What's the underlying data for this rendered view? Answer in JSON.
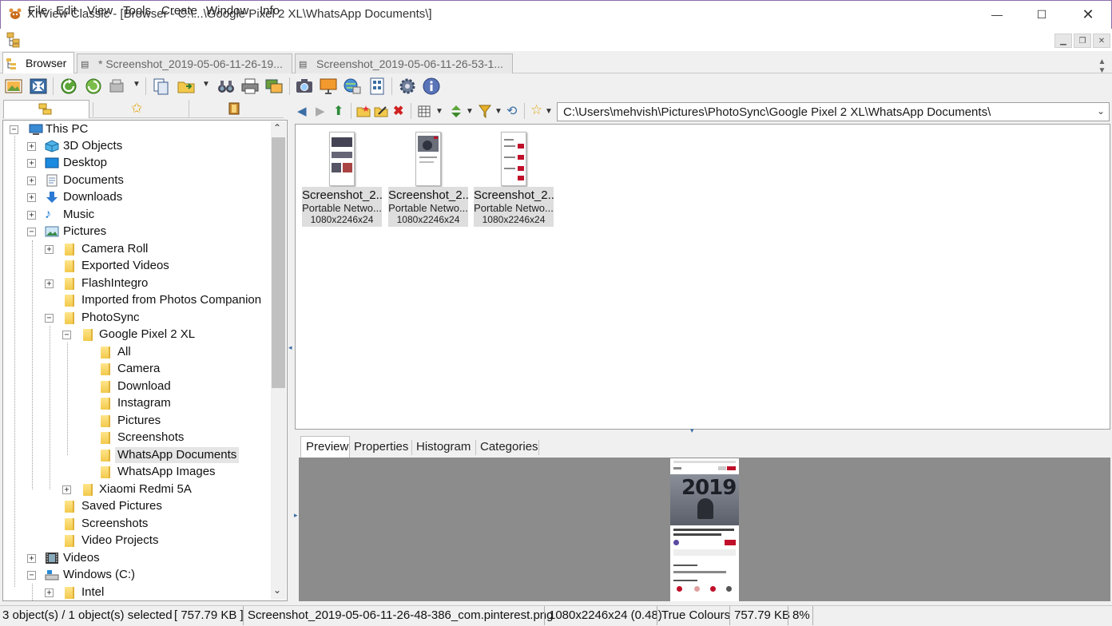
{
  "window": {
    "title": "XnView Classic - [Browser - C:\\...\\Google Pixel 2 XL\\WhatsApp Documents\\]",
    "minimize": "—",
    "maximize": "☐",
    "close": "✕"
  },
  "menu": [
    "File",
    "Edit",
    "View",
    "Tools",
    "Create",
    "Window",
    "Info"
  ],
  "mdi": {
    "minimize": "▁",
    "restore": "❐",
    "close": "✕"
  },
  "tabs": [
    {
      "label": "Browser"
    },
    {
      "label": "* Screenshot_2019-05-06-11-26-19..."
    },
    {
      "label": "Screenshot_2019-05-06-11-26-53-1..."
    }
  ],
  "path": {
    "value": "C:\\Users\\mehvish\\Pictures\\PhotoSync\\Google Pixel 2 XL\\WhatsApp Documents\\"
  },
  "tree": [
    {
      "label": "This PC",
      "icon": "computer-icon"
    },
    {
      "label": "3D Objects",
      "icon": "cube-icon"
    },
    {
      "label": "Desktop",
      "icon": "desktop-icon"
    },
    {
      "label": "Documents",
      "icon": "document-icon"
    },
    {
      "label": "Downloads",
      "icon": "download-arrow-icon"
    },
    {
      "label": "Music",
      "icon": "music-note-icon"
    },
    {
      "label": "Pictures",
      "icon": "pictures-icon"
    },
    {
      "label": "Camera Roll",
      "icon": "folder-icon"
    },
    {
      "label": "Exported Videos",
      "icon": "folder-icon"
    },
    {
      "label": "FlashIntegro",
      "icon": "folder-icon"
    },
    {
      "label": "Imported from Photos Companion",
      "icon": "folder-icon"
    },
    {
      "label": "PhotoSync",
      "icon": "folder-icon"
    },
    {
      "label": "Google Pixel 2 XL",
      "icon": "folder-icon"
    },
    {
      "label": "All",
      "icon": "folder-icon"
    },
    {
      "label": "Camera",
      "icon": "folder-icon"
    },
    {
      "label": "Download",
      "icon": "folder-icon"
    },
    {
      "label": "Instagram",
      "icon": "folder-icon"
    },
    {
      "label": "Pictures",
      "icon": "folder-icon"
    },
    {
      "label": "Screenshots",
      "icon": "folder-icon"
    },
    {
      "label": "WhatsApp Documents",
      "icon": "folder-icon",
      "selected": true
    },
    {
      "label": "WhatsApp Images",
      "icon": "folder-icon"
    },
    {
      "label": "Xiaomi Redmi 5A",
      "icon": "folder-icon"
    },
    {
      "label": "Saved Pictures",
      "icon": "folder-icon"
    },
    {
      "label": "Screenshots",
      "icon": "folder-icon"
    },
    {
      "label": "Video Projects",
      "icon": "folder-icon"
    },
    {
      "label": "Videos",
      "icon": "film-icon"
    },
    {
      "label": "Windows (C:)",
      "icon": "drive-icon"
    },
    {
      "label": "Intel",
      "icon": "folder-icon"
    }
  ],
  "thumbnails": [
    {
      "name": "Screenshot_2...",
      "type": "Portable Netwo...",
      "dims": "1080x2246x24"
    },
    {
      "name": "Screenshot_2...",
      "type": "Portable Netwo...",
      "dims": "1080x2246x24"
    },
    {
      "name": "Screenshot_2...",
      "type": "Portable Netwo...",
      "dims": "1080x2246x24"
    }
  ],
  "preview_tabs": [
    "Preview",
    "Properties",
    "Histogram",
    "Categories"
  ],
  "preview_image": {
    "banner_text": "2019"
  },
  "status": {
    "objects": "3 object(s) / 1 object(s) selected",
    "size_selected": "[ 757.79 KB ]",
    "filename": "Screenshot_2019-05-06-11-26-48-386_com.pinterest.png",
    "dimensions": "1080x2246x24 (0.48)",
    "colours": "True Colours",
    "filesize": "757.79 KB",
    "zoom": "8%"
  },
  "colors": {
    "selection": "#cce8ff",
    "folder": "#f2c94c",
    "preview_bg": "#8c8c8c",
    "accent_red": "#c0102a"
  }
}
